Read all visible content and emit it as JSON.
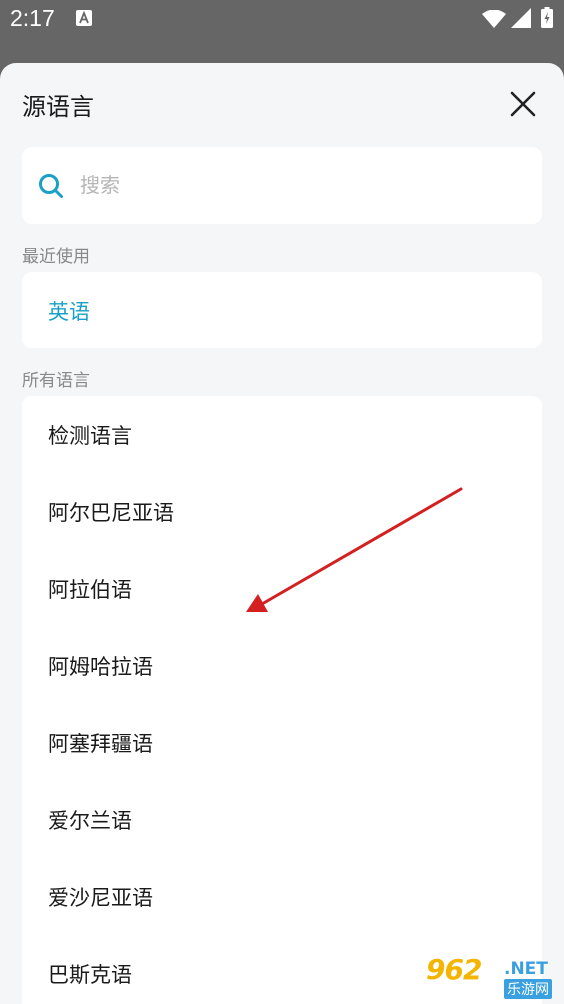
{
  "status_bar": {
    "time": "2:17"
  },
  "sheet": {
    "title": "源语言",
    "close_icon": "close-icon"
  },
  "search": {
    "placeholder": "搜索",
    "value": "",
    "icon": "search-icon"
  },
  "recent": {
    "label": "最近使用",
    "items": [
      "英语"
    ]
  },
  "all_languages": {
    "label": "所有语言",
    "items": [
      "检测语言",
      "阿尔巴尼亚语",
      "阿拉伯语",
      "阿姆哈拉语",
      "阿塞拜疆语",
      "爱尔兰语",
      "爱沙尼亚语",
      "巴斯克语"
    ]
  },
  "annotation": {
    "color": "#d42020"
  },
  "watermark": {
    "logo": "962",
    "domain": ".NET",
    "sub": "乐游网"
  },
  "colors": {
    "accent": "#1aa0c6",
    "sheet_bg": "#f5f6f8",
    "card_bg": "#ffffff"
  }
}
